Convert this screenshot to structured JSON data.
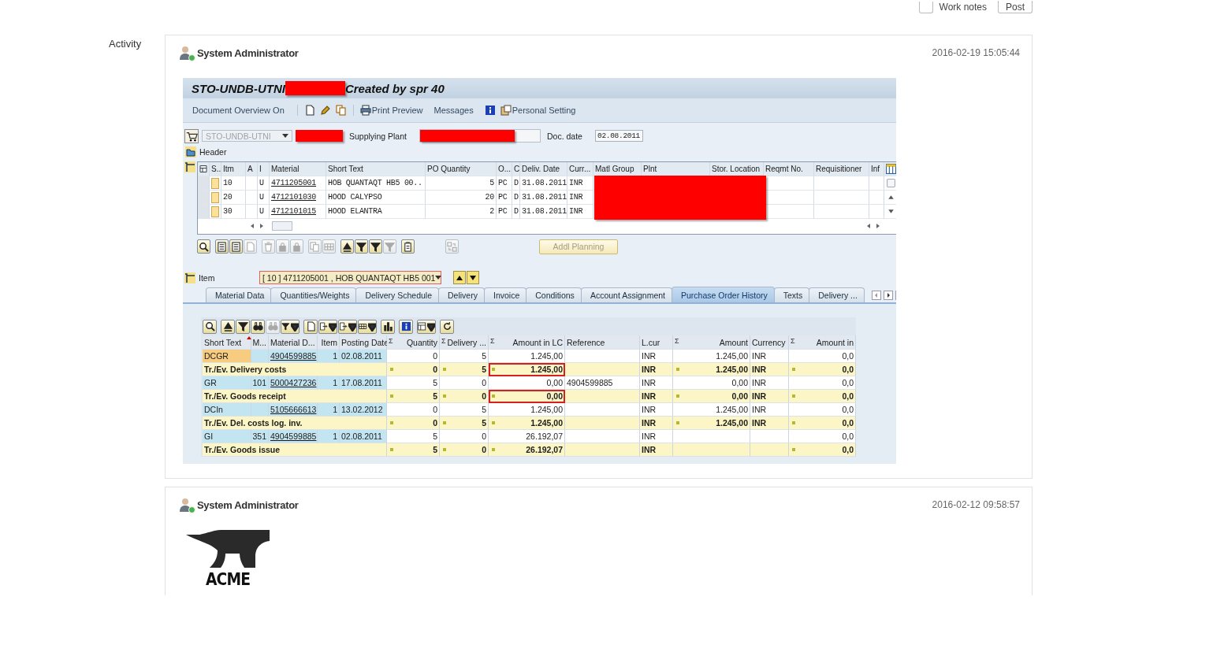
{
  "compose": {
    "work_notes": {
      "label": "Work notes",
      "checked": false
    },
    "post_button": "Post"
  },
  "activity_label": "Activity",
  "entries": [
    {
      "author": "System Administrator",
      "online": true,
      "time": "2016-02-19 15:05:44",
      "attachment": {
        "kind": "sap",
        "title_left": "STO-UNDB-UTNI",
        "title_right": "Created by spr 40",
        "toolbar": {
          "overview": "Document Overview On",
          "print": "Print Preview",
          "messages": "Messages",
          "settings": "Personal Setting"
        },
        "doc_type": {
          "value": "STO-UNDB-UTNI",
          "disabled": true
        },
        "supplying_plant_label": "Supplying Plant",
        "doc_date_label": "Doc. date",
        "doc_date": "02.08.2011",
        "header_label": "Header",
        "item_columns": [
          "S..",
          "Itm",
          "A",
          "I",
          "Material",
          "Short Text",
          "PO Quantity",
          "O...",
          "C",
          "Deliv. Date",
          "Curr...",
          "Matl Group",
          "Plnt",
          "Stor. Location",
          "Reqmt No.",
          "Requisitioner",
          "Inf"
        ],
        "item_rows": [
          {
            "item": "10",
            "i": "U",
            "material": "4711205001",
            "short_text": "HOB QUANTAQT HB5 00..",
            "quantity": "5",
            "unit": "PC",
            "c": "D",
            "deliv_date": "31.08.2011",
            "currency": "INR"
          },
          {
            "item": "20",
            "i": "U",
            "material": "4712101030",
            "short_text": "HOOD CALYPSO",
            "quantity": "20",
            "unit": "PC",
            "c": "D",
            "deliv_date": "31.08.2011",
            "currency": "INR"
          },
          {
            "item": "30",
            "i": "U",
            "material": "4712101015",
            "short_text": "HOOD ELANTRA",
            "quantity": "2",
            "unit": "PC",
            "c": "D",
            "deliv_date": "31.08.2011",
            "currency": "INR"
          }
        ],
        "addl_planning": {
          "label": "Addl Planning",
          "disabled": true
        },
        "item_label": "Item",
        "item_value": "[ 10 ] 4711205001 , HOB QUANTAQT HB5 001",
        "tabs": [
          {
            "label": "Material Data",
            "selected": false
          },
          {
            "label": "Quantities/Weights",
            "selected": false
          },
          {
            "label": "Delivery Schedule",
            "selected": false
          },
          {
            "label": "Delivery",
            "selected": false
          },
          {
            "label": "Invoice",
            "selected": false
          },
          {
            "label": "Conditions",
            "selected": false
          },
          {
            "label": "Account Assignment",
            "selected": false
          },
          {
            "label": "Purchase Order History",
            "selected": true
          },
          {
            "label": "Texts",
            "selected": false
          },
          {
            "label": "Delivery ...",
            "selected": false
          }
        ],
        "history_columns": [
          {
            "label": "Short Text",
            "sorted": true
          },
          {
            "label": "M...",
            "sorted": false
          },
          {
            "label": "Material D...",
            "sorted": false
          },
          {
            "label": "Item",
            "sorted": false
          },
          {
            "label": "Posting Date",
            "sorted": false
          },
          {
            "label": "Quantity",
            "sum_sign": "Σ",
            "sorted": false
          },
          {
            "label": "Delivery ...",
            "sum_sign": "Σ",
            "sorted": false
          },
          {
            "label": "Amount in LC",
            "sum_sign": "Σ",
            "sorted": false
          },
          {
            "label": "Reference",
            "sorted": false
          },
          {
            "label": "L.cur",
            "sorted": false
          },
          {
            "label": "Amount",
            "sum_sign": "Σ",
            "sorted": false
          },
          {
            "label": "Currency",
            "sorted": false
          },
          {
            "label": "Amount in",
            "sum_sign": "Σ",
            "sorted": false
          }
        ],
        "history_rows": [
          {
            "kind": "detail",
            "selected": true,
            "flagged": false,
            "short_text": "DCGR",
            "material_doc": "4904599885",
            "item": "1",
            "posting_date": "02.08.2011",
            "quantity": "0",
            "delivery": "5",
            "amount_lc": "1.245,00",
            "lcur": "INR",
            "amount": "1.245,00",
            "currency": "INR",
            "amount_in": "0,0"
          },
          {
            "kind": "total",
            "flagged": true,
            "label": "Tr./Ev. Delivery costs",
            "quantity": "0",
            "delivery": "5",
            "amount_lc": "1.245,00",
            "lcur": "INR",
            "amount": "1.245,00",
            "currency": "INR",
            "amount_in": "0,0"
          },
          {
            "kind": "detail",
            "selected": false,
            "flagged": false,
            "short_text": "GR",
            "m": "101",
            "material_doc": "5000427236",
            "item": "1",
            "posting_date": "17.08.2011",
            "quantity": "5",
            "delivery": "0",
            "amount_lc": "0,00",
            "reference": "4904599885",
            "lcur": "INR",
            "amount": "0,00",
            "currency": "INR",
            "amount_in": "0,0"
          },
          {
            "kind": "total",
            "flagged": true,
            "label": "Tr./Ev. Goods receipt",
            "quantity": "5",
            "delivery": "0",
            "amount_lc": "0,00",
            "lcur": "INR",
            "amount": "0,00",
            "currency": "INR",
            "amount_in": "0,0"
          },
          {
            "kind": "detail",
            "selected": false,
            "flagged": false,
            "short_text": "DCIn",
            "material_doc": "5105666613",
            "item": "1",
            "posting_date": "13.02.2012",
            "quantity": "0",
            "delivery": "5",
            "amount_lc": "1.245,00",
            "lcur": "INR",
            "amount": "1.245,00",
            "currency": "INR",
            "amount_in": "0,0"
          },
          {
            "kind": "total",
            "flagged": false,
            "label": "Tr./Ev. Del. costs log. inv.",
            "quantity": "0",
            "delivery": "5",
            "amount_lc": "1.245,00",
            "lcur": "INR",
            "amount": "1.245,00",
            "currency": "INR",
            "amount_in": "0,0"
          },
          {
            "kind": "detail",
            "selected": false,
            "flagged": false,
            "short_text": "GI",
            "m": "351",
            "material_doc": "4904599885",
            "item": "1",
            "posting_date": "02.08.2011",
            "quantity": "5",
            "delivery": "0",
            "amount_lc": "26.192,07",
            "lcur": "INR",
            "amount_in": "0,0"
          },
          {
            "kind": "total",
            "flagged": false,
            "label": "Tr./Ev. Goods issue",
            "quantity": "5",
            "delivery": "0",
            "amount_lc": "26.192,07",
            "lcur": "INR",
            "amount_in": "0,0"
          }
        ]
      }
    },
    {
      "author": "System Administrator",
      "online": true,
      "time": "2016-02-12 09:58:57",
      "attachment": {
        "kind": "logo",
        "text": "ACME"
      }
    }
  ]
}
